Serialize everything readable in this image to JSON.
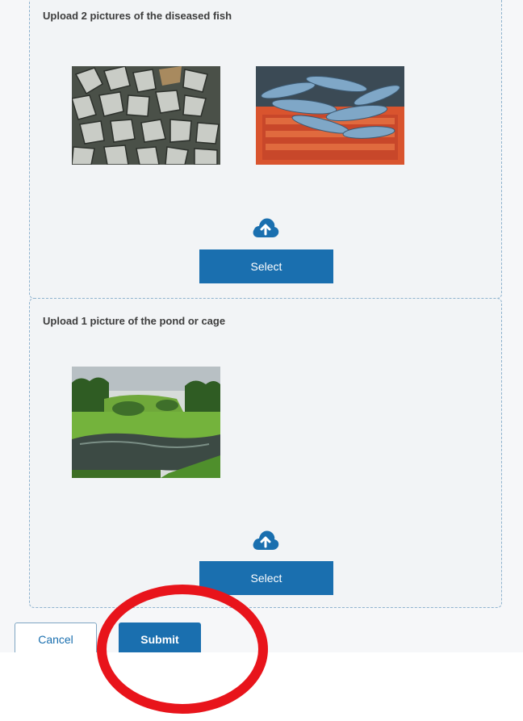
{
  "sections": [
    {
      "title": "Upload 2 pictures of the diseased fish",
      "select_label": "Select",
      "thumbnails": [
        "fish-pile-thumbnail",
        "fish-crate-thumbnail"
      ]
    },
    {
      "title": "Upload 1 picture of the pond or cage",
      "select_label": "Select",
      "thumbnails": [
        "pond-thumbnail"
      ]
    }
  ],
  "footer": {
    "cancel_label": "Cancel",
    "submit_label": "Submit"
  },
  "colors": {
    "primary": "#1a6faf",
    "annotation": "#e8141b",
    "border": "#8fb3cf"
  },
  "icons": {
    "upload": "cloud-upload-icon"
  }
}
